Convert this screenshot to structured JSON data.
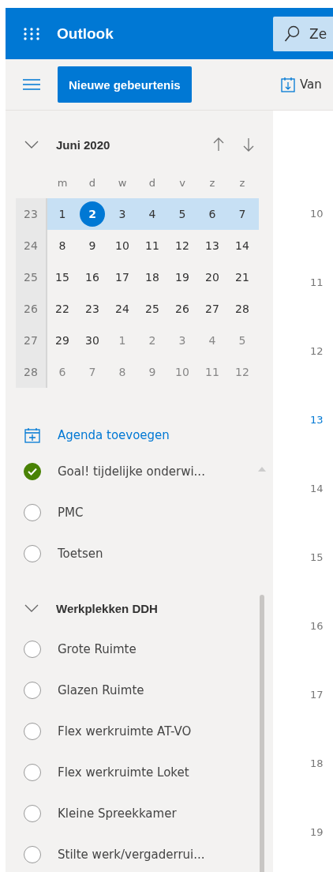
{
  "header": {
    "app_name": "Outlook",
    "search": {
      "value": "Ze"
    }
  },
  "toolbar": {
    "new_event_button": "Nieuwe gebeurtenis",
    "view_label": "Van"
  },
  "mini_calendar": {
    "month": "Juni 2020",
    "expanded": true,
    "weekdays": [
      "m",
      "d",
      "w",
      "d",
      "v",
      "z",
      "z"
    ],
    "weeks": [
      {
        "week": "23",
        "selected": true,
        "days": [
          {
            "day": "1",
            "today": false,
            "other_month": false
          },
          {
            "day": "2",
            "today": true,
            "other_month": false
          },
          {
            "day": "3",
            "today": false,
            "other_month": false
          },
          {
            "day": "4",
            "today": false,
            "other_month": false
          },
          {
            "day": "5",
            "today": false,
            "other_month": false
          },
          {
            "day": "6",
            "today": false,
            "other_month": false
          },
          {
            "day": "7",
            "today": false,
            "other_month": false
          }
        ]
      },
      {
        "week": "24",
        "selected": false,
        "days": [
          {
            "day": "8",
            "today": false,
            "other_month": false
          },
          {
            "day": "9",
            "today": false,
            "other_month": false
          },
          {
            "day": "10",
            "today": false,
            "other_month": false
          },
          {
            "day": "11",
            "today": false,
            "other_month": false
          },
          {
            "day": "12",
            "today": false,
            "other_month": false
          },
          {
            "day": "13",
            "today": false,
            "other_month": false
          },
          {
            "day": "14",
            "today": false,
            "other_month": false
          }
        ]
      },
      {
        "week": "25",
        "selected": false,
        "days": [
          {
            "day": "15",
            "today": false,
            "other_month": false
          },
          {
            "day": "16",
            "today": false,
            "other_month": false
          },
          {
            "day": "17",
            "today": false,
            "other_month": false
          },
          {
            "day": "18",
            "today": false,
            "other_month": false
          },
          {
            "day": "19",
            "today": false,
            "other_month": false
          },
          {
            "day": "20",
            "today": false,
            "other_month": false
          },
          {
            "day": "21",
            "today": false,
            "other_month": false
          }
        ]
      },
      {
        "week": "26",
        "selected": false,
        "days": [
          {
            "day": "22",
            "today": false,
            "other_month": false
          },
          {
            "day": "23",
            "today": false,
            "other_month": false
          },
          {
            "day": "24",
            "today": false,
            "other_month": false
          },
          {
            "day": "25",
            "today": false,
            "other_month": false
          },
          {
            "day": "26",
            "today": false,
            "other_month": false
          },
          {
            "day": "27",
            "today": false,
            "other_month": false
          },
          {
            "day": "28",
            "today": false,
            "other_month": false
          }
        ]
      },
      {
        "week": "27",
        "selected": false,
        "days": [
          {
            "day": "29",
            "today": false,
            "other_month": false
          },
          {
            "day": "30",
            "today": false,
            "other_month": false
          },
          {
            "day": "1",
            "today": false,
            "other_month": true
          },
          {
            "day": "2",
            "today": false,
            "other_month": true
          },
          {
            "day": "3",
            "today": false,
            "other_month": true
          },
          {
            "day": "4",
            "today": false,
            "other_month": true
          },
          {
            "day": "5",
            "today": false,
            "other_month": true
          }
        ]
      },
      {
        "week": "28",
        "selected": false,
        "days": [
          {
            "day": "6",
            "today": false,
            "other_month": true
          },
          {
            "day": "7",
            "today": false,
            "other_month": true
          },
          {
            "day": "8",
            "today": false,
            "other_month": true
          },
          {
            "day": "9",
            "today": false,
            "other_month": true
          },
          {
            "day": "10",
            "today": false,
            "other_month": true
          },
          {
            "day": "11",
            "today": false,
            "other_month": true
          },
          {
            "day": "12",
            "today": false,
            "other_month": true
          }
        ]
      }
    ]
  },
  "add_calendar": "Agenda toevoegen",
  "calendars": [
    {
      "name": "Goal! tijdelijke onderwi...",
      "checked": true
    },
    {
      "name": "PMC",
      "checked": false
    },
    {
      "name": "Toetsen",
      "checked": false
    }
  ],
  "groups": [
    {
      "name": "Werkplekken DDH",
      "expanded": true,
      "calendars": [
        {
          "name": "Grote Ruimte",
          "checked": false
        },
        {
          "name": "Glazen Ruimte",
          "checked": false
        },
        {
          "name": "Flex werkruimte AT-VO",
          "checked": false
        },
        {
          "name": "Flex werkruimte Loket",
          "checked": false
        },
        {
          "name": "Kleine Spreekkamer",
          "checked": false
        },
        {
          "name": "Stilte werk/vergaderrui...",
          "checked": false
        }
      ]
    }
  ],
  "hours": [
    {
      "label": "10",
      "current": false
    },
    {
      "label": "11",
      "current": false
    },
    {
      "label": "12",
      "current": false
    },
    {
      "label": "13",
      "current": true
    },
    {
      "label": "14",
      "current": false
    },
    {
      "label": "15",
      "current": false
    },
    {
      "label": "16",
      "current": false
    },
    {
      "label": "17",
      "current": false
    },
    {
      "label": "18",
      "current": false
    },
    {
      "label": "19",
      "current": false
    }
  ]
}
